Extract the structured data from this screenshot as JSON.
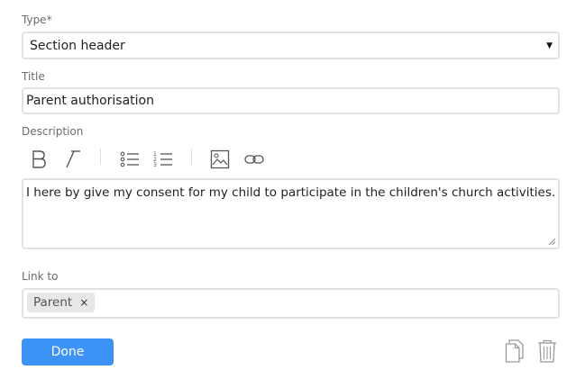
{
  "type_field": {
    "label": "Type*",
    "value": "Section header",
    "arrow": "▼"
  },
  "title_field": {
    "label": "Title",
    "value": "Parent authorisation"
  },
  "description_field": {
    "label": "Description",
    "toolbar": [
      "bold-icon",
      "italic-icon",
      "bulleted-list-icon",
      "numbered-list-icon",
      "image-icon",
      "link-icon"
    ],
    "value": "I here by give my consent for my child to participate in the children's church activities."
  },
  "link_field": {
    "label": "Link to",
    "chips": [
      {
        "label": "Parent",
        "remove": "×"
      }
    ]
  },
  "actions": {
    "done_label": "Done",
    "icons": [
      "copy-icon",
      "trash-icon"
    ]
  },
  "colors": {
    "primary": "#3d93f5",
    "border": "#e2e2e2",
    "chip_bg": "#e8e8e8"
  }
}
